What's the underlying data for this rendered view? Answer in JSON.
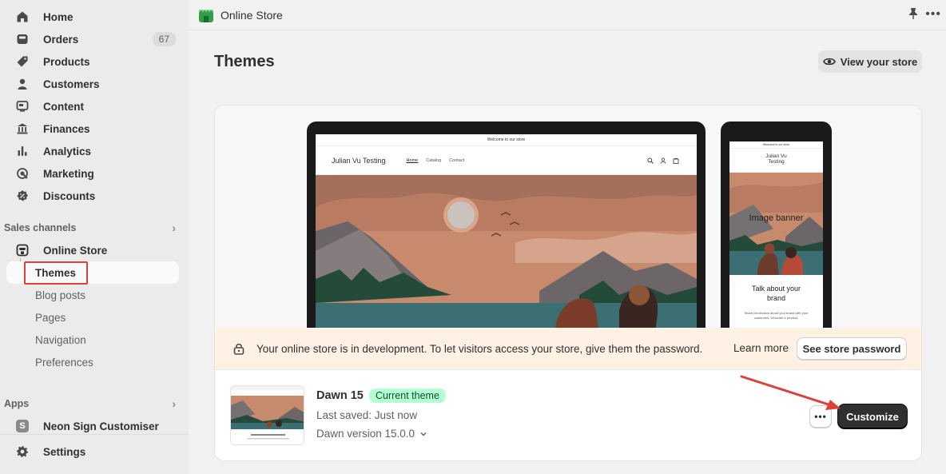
{
  "sidebar": {
    "items": [
      {
        "label": "Home",
        "icon": "home-icon"
      },
      {
        "label": "Orders",
        "icon": "orders-icon",
        "badge": "67"
      },
      {
        "label": "Products",
        "icon": "tag-icon"
      },
      {
        "label": "Customers",
        "icon": "person-icon"
      },
      {
        "label": "Content",
        "icon": "content-icon"
      },
      {
        "label": "Finances",
        "icon": "bank-icon"
      },
      {
        "label": "Analytics",
        "icon": "bar-chart-icon"
      },
      {
        "label": "Marketing",
        "icon": "target-icon"
      },
      {
        "label": "Discounts",
        "icon": "discount-icon"
      }
    ],
    "sales_channels_label": "Sales channels",
    "online_store": {
      "label": "Online Store",
      "subitems": [
        "Themes",
        "Blog posts",
        "Pages",
        "Navigation",
        "Preferences"
      ]
    },
    "apps_label": "Apps",
    "app_item": {
      "label": "Neon Sign Customiser",
      "tile": "S"
    },
    "settings_label": "Settings"
  },
  "topbar": {
    "title": "Online Store"
  },
  "page": {
    "title": "Themes",
    "view_store_label": "View your store"
  },
  "preview": {
    "desktop": {
      "announcement": "Welcome to our store",
      "store_name": "Julian Vu Testing",
      "nav": [
        "Home",
        "Catalog",
        "Contact"
      ]
    },
    "mobile": {
      "announcement": "Welcome to our store",
      "store_name_line1": "Julian Vu",
      "store_name_line2": "Testing",
      "banner_title": "Image banner",
      "banner_sub": "Give customers details about the banner",
      "brand_title_line1": "Talk about your",
      "brand_title_line2": "brand",
      "brand_desc": "Share information about your brand with your customers. Describe a product,"
    }
  },
  "dev_banner": {
    "message": "Your online store is in development. To let visitors access your store, give them the password.",
    "learn_more": "Learn more",
    "password_button": "See store password"
  },
  "theme": {
    "name": "Dawn 15",
    "badge": "Current theme",
    "last_saved": "Last saved: Just now",
    "version": "Dawn version 15.0.0",
    "customize_label": "Customize",
    "more_label": "•••"
  },
  "colors": {
    "sidebar_bg": "#ebebeb",
    "page_bg": "#f1f1f1",
    "badge_green": "#b4fed2",
    "dev_banner_bg": "#fff1e3",
    "primary_button": "#303030",
    "annotation_red": "#e0403a"
  }
}
